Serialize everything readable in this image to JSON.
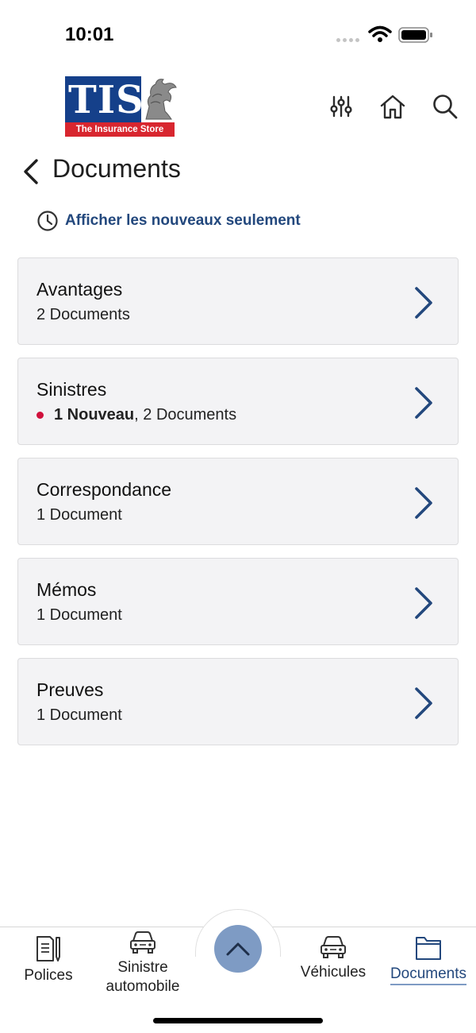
{
  "status_bar": {
    "time": "10:01"
  },
  "logo": {
    "text": "TIS",
    "subtitle": "The Insurance Store"
  },
  "header": {
    "icons": [
      "filter-sliders-icon",
      "home-icon",
      "search-icon"
    ]
  },
  "page": {
    "title": "Documents",
    "filter_link": "Afficher les nouveaux seulement"
  },
  "categories": [
    {
      "title": "Avantages",
      "count": "2 Documents",
      "new_label": ""
    },
    {
      "title": "Sinistres",
      "count": ", 2 Documents",
      "new_label": "1 Nouveau"
    },
    {
      "title": "Correspondance",
      "count": "1 Document",
      "new_label": ""
    },
    {
      "title": "Mémos",
      "count": "1 Document",
      "new_label": ""
    },
    {
      "title": "Preuves",
      "count": "1 Document",
      "new_label": ""
    }
  ],
  "tabbar": {
    "polices": "Polices",
    "sinistre_line1": "Sinistre",
    "sinistre_line2": "automobile",
    "vehicules": "Véhicules",
    "documents": "Documents",
    "active": "Documents"
  },
  "colors": {
    "accent": "#23487d",
    "new_dot": "#d0113c",
    "card_bg": "#f3f3f5",
    "fab": "#7e9bc4",
    "logo_blue": "#15408a",
    "logo_red": "#d8262f"
  }
}
